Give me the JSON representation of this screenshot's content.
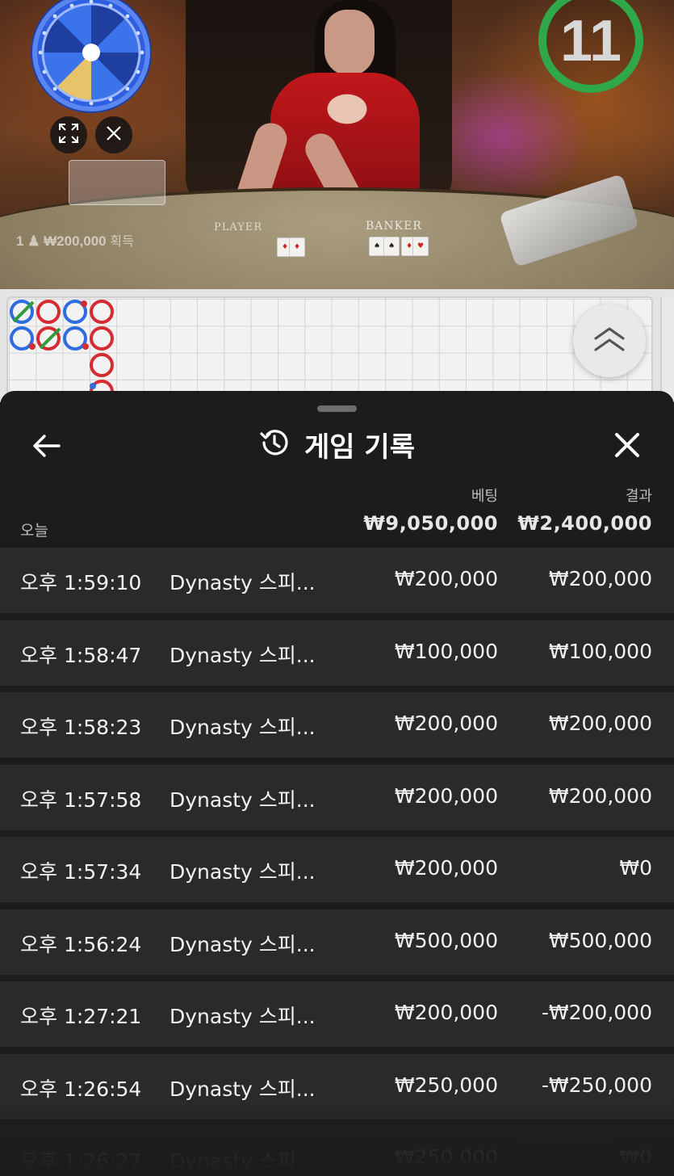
{
  "video": {
    "timer": "11",
    "win_amount": "1 ♟ ₩200,000",
    "win_suffix": "획득",
    "table_player_label": "PLAYER",
    "table_banker_label": "BANKER"
  },
  "sheet": {
    "title": "게임 기록",
    "columns": {
      "bet": "베팅",
      "result": "결과"
    },
    "today_label": "오늘",
    "totals": {
      "bet": "₩9,050,000",
      "result": "₩2,400,000"
    },
    "rows": [
      {
        "time": "오후 1:59:10",
        "game": "Dynasty 스피...",
        "bet": "₩200,000",
        "result": "₩200,000"
      },
      {
        "time": "오후 1:58:47",
        "game": "Dynasty 스피...",
        "bet": "₩100,000",
        "result": "₩100,000"
      },
      {
        "time": "오후 1:58:23",
        "game": "Dynasty 스피...",
        "bet": "₩200,000",
        "result": "₩200,000"
      },
      {
        "time": "오후 1:57:58",
        "game": "Dynasty 스피...",
        "bet": "₩200,000",
        "result": "₩200,000"
      },
      {
        "time": "오후 1:57:34",
        "game": "Dynasty 스피...",
        "bet": "₩200,000",
        "result": "₩0"
      },
      {
        "time": "오후 1:56:24",
        "game": "Dynasty 스피...",
        "bet": "₩500,000",
        "result": "₩500,000"
      },
      {
        "time": "오후 1:27:21",
        "game": "Dynasty 스피...",
        "bet": "₩200,000",
        "result": "-₩200,000"
      },
      {
        "time": "오후 1:26:54",
        "game": "Dynasty 스피...",
        "bet": "₩250,000",
        "result": "-₩250,000"
      },
      {
        "time": "오후 1:26:27",
        "game": "Dynasty 스피...",
        "bet": "₩250,000",
        "result": "₩0"
      }
    ]
  },
  "icons": {
    "back": "arrow-left-icon",
    "history": "history-icon",
    "close": "close-icon",
    "expand": "fullscreen-icon",
    "road_toggle": "chevron-double-up-icon"
  },
  "colors": {
    "timer_ring": "#2fa84a",
    "sheet_bg": "#1c1c1c",
    "row_bg": "#2a2a2a",
    "bead_red": "#d62b33",
    "bead_blue": "#2f6ce0",
    "tie_green": "#2f9b3a"
  }
}
